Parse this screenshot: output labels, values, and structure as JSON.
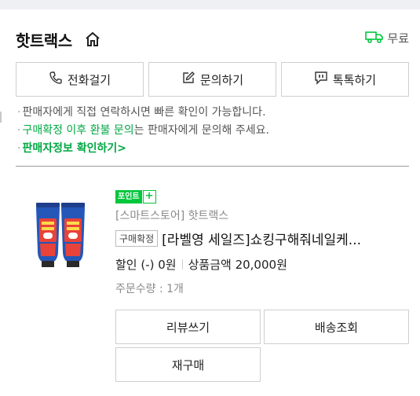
{
  "store": {
    "name": "핫트랙스",
    "home_icon": "home-icon",
    "shipping_label": "무료",
    "shipping_icon": "truck-icon"
  },
  "contact": {
    "call_label": "전화걸기",
    "inquiry_label": "문의하기",
    "talk_label": "톡톡하기"
  },
  "notes": {
    "line1": "판매자에게 직접 연락하시면 빠른 확인이 가능합니다.",
    "line2_highlight": "구매확정 이후 환불 문의",
    "line2_rest": "는 판매자에게 문의해 주세요.",
    "line3_link": "판매자정보 확인하기",
    "line3_arrow": ">"
  },
  "product": {
    "point_badge": "포인트",
    "point_plus": "+",
    "seller": "[스마트스토어] 핫트랙스",
    "confirm_badge": "구매확정",
    "title": "[라벨영 세일즈]쇼킹구해줘네일케...",
    "discount": "할인 (-) 0원",
    "amount": "상품금액 20,000원",
    "quantity": "주문수량 : 1개"
  },
  "actions": {
    "review_label": "리뷰쓰기",
    "shipping_check_label": "배송조회",
    "rebuy_label": "재구매"
  },
  "colors": {
    "accent_green": "#00c73c",
    "link_green": "#00a843"
  }
}
